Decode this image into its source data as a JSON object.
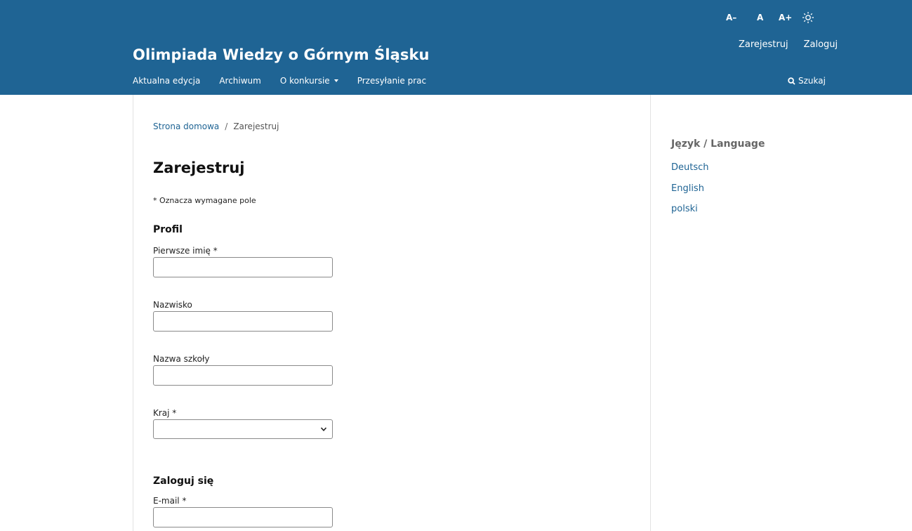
{
  "header": {
    "title": "Olimpiada Wiedzy o Górnym Śląsku",
    "font_controls": {
      "decrease": "A–",
      "normal": "A",
      "increase": "A+"
    },
    "user_links": {
      "register": "Zarejestruj",
      "login": "Zaloguj"
    },
    "nav": {
      "items": [
        {
          "label": "Aktualna edycja"
        },
        {
          "label": "Archiwum"
        },
        {
          "label": "O konkursie"
        },
        {
          "label": "Przesyłanie prac"
        }
      ],
      "search_label": "Szukaj"
    }
  },
  "breadcrumb": {
    "home": "Strona domowa",
    "separator": "/",
    "current": "Zarejestruj"
  },
  "page": {
    "title": "Zarejestruj",
    "required_note": "* Oznacza wymagane pole"
  },
  "form": {
    "profile_section": "Profil",
    "first_name_label": "Pierwsze imię *",
    "first_name_value": "",
    "last_name_label": "Nazwisko",
    "last_name_value": "",
    "school_label": "Nazwa szkoły",
    "school_value": "",
    "country_label": "Kraj *",
    "country_selected": "",
    "login_section": "Zaloguj się",
    "email_label": "E-mail *",
    "email_value": ""
  },
  "sidebar": {
    "title": "Język / Language",
    "languages": [
      {
        "label": "Deutsch"
      },
      {
        "label": "English"
      },
      {
        "label": "polski"
      }
    ]
  },
  "colors": {
    "header_bg": "#1f6494",
    "link": "#1f6494",
    "sidebar_title": "#666666"
  },
  "icons": {
    "theme_toggle": "sun-icon",
    "search": "search-icon",
    "dropdown": "chevron-down-icon",
    "menu_caret": "caret-down-icon"
  }
}
